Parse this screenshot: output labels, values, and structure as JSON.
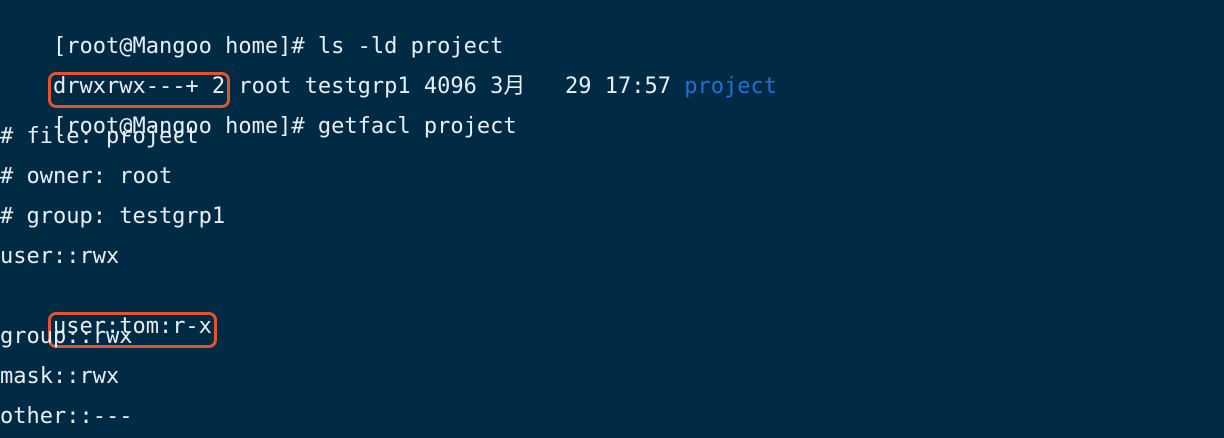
{
  "terminal": {
    "lines": [
      {
        "prompt": "[root@Mangoo home]#",
        "command": " ls -ld project"
      },
      {
        "perms": "drwxrwx---+ 2",
        "rest": " root testgrp1 4096 3月   29 17:57 ",
        "dirname": "project"
      },
      {
        "prompt": "[root@Mangoo home]#",
        "command": " getfacl project"
      },
      {
        "text": "# file: project"
      },
      {
        "text": "# owner: root"
      },
      {
        "text": "# group: testgrp1"
      },
      {
        "text": "user::rwx"
      },
      {
        "text": "user:tom:r-x"
      },
      {
        "text": "group::rwx"
      },
      {
        "text": "mask::rwx"
      },
      {
        "text": "other::---"
      }
    ]
  },
  "colors": {
    "background": "#012a44",
    "text": "#e8edf0",
    "directory": "#1f6fd6",
    "highlight_box": "#e2542f"
  }
}
